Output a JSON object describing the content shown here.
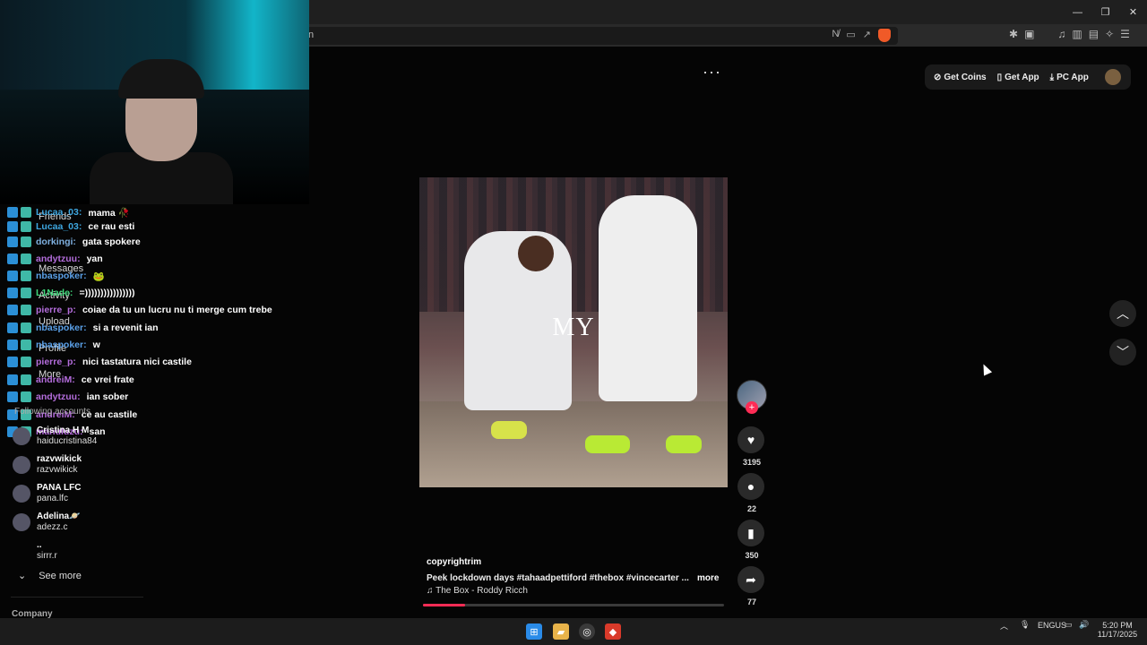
{
  "browser": {
    "url_fragment": "n",
    "window_controls": {
      "minimize": "—",
      "restore": "❐",
      "close": "✕"
    }
  },
  "header": {
    "more_icon": "···",
    "get_coins": "Get Coins",
    "get_app": "Get App",
    "pc_app": "PC App"
  },
  "sidebar": {
    "nav_ghosts": [
      "Friends",
      "Messages",
      "Activity",
      "Upload",
      "Profile",
      "More"
    ],
    "chat": [
      {
        "user": "Lucaa_03:",
        "msg": "mama 🥀",
        "color": "#3ea7e0"
      },
      {
        "user": "Lucaa_03:",
        "msg": "ce rau esti",
        "color": "#3ea7e0"
      },
      {
        "user": "dorkingi:",
        "msg": "gata spokere",
        "color": "#7fb0e0"
      },
      {
        "user": "andytzuu:",
        "msg": "yan",
        "color": "#b46ddc"
      },
      {
        "user": "nbaspoker:",
        "msg": "🐸",
        "color": "#5aa0e8"
      },
      {
        "user": "L1Nade:",
        "msg": "=))))))))))))))))",
        "color": "#3fd67a"
      },
      {
        "user": "pierre_p:",
        "msg": "coiae da tu un lucru nu ti merge cum trebe",
        "color": "#b46ddc"
      },
      {
        "user": "nbaspoker:",
        "msg": "si a revenit ian",
        "color": "#5aa0e8"
      },
      {
        "user": "nbaspoker:",
        "msg": "w",
        "color": "#5aa0e8"
      },
      {
        "user": "pierre_p:",
        "msg": "nici tastatura nici castile",
        "color": "#b46ddc"
      },
      {
        "user": "andreiM:",
        "msg": "ce vrei frate",
        "color": "#b46ddc"
      },
      {
        "user": "andytzuu:",
        "msg": "ian sober",
        "color": "#b46ddc"
      },
      {
        "user": "andreiM:",
        "msg": "ce au castile",
        "color": "#b46ddc"
      },
      {
        "user": "manuluzu:",
        "msg": "san",
        "color": "#b46ddc"
      }
    ],
    "following_title": "Following accounts",
    "accounts": [
      {
        "name": "Cristina H M",
        "handle": "haiducristina84"
      },
      {
        "name": "razvwikick",
        "handle": "razvwikick"
      },
      {
        "name": "PANA LFC",
        "handle": "pana.lfc"
      },
      {
        "name": "Adelina🪐",
        "handle": "adezz.c"
      },
      {
        "name": "..",
        "handle": "sirrr.r"
      }
    ],
    "see_more": "See more",
    "company": "Company"
  },
  "video": {
    "overlay_text": "MY",
    "progress": 0.14
  },
  "actions": {
    "likes": "3195",
    "comments": "22",
    "saves": "350",
    "shares": "77"
  },
  "caption": {
    "user": "copyrightrim",
    "description": "Peek lockdown days #tahaadpettiford  #thebox  #vincecarter  ...",
    "more": "more",
    "music": "♫  The Box - Roddy Ricch"
  },
  "taskbar": {
    "lang_line1": "ENG",
    "lang_line2": "US",
    "time": "5:20 PM",
    "date": "11/17/2025"
  }
}
